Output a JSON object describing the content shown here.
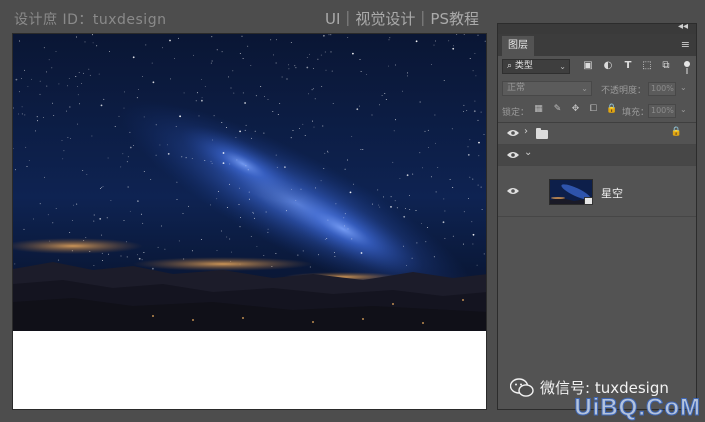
{
  "watermark": {
    "left": "设计庶 ID：tuxdesign",
    "right": "UI｜视觉设计｜PS教程"
  },
  "layers_panel": {
    "tab": "图层",
    "collapse_glyph": "◂◂",
    "menu_glyph": "≡",
    "filter_kind": "类型",
    "filter_icons": [
      "image-filter-icon",
      "adjustment-filter-icon",
      "type-filter-icon",
      "shape-filter-icon",
      "smart-object-filter-icon"
    ],
    "blend_mode": "正常",
    "opacity_label": "不透明度：",
    "opacity_value": "100%",
    "lock_label": "锁定：",
    "fill_label": "填充：",
    "fill_value": "100%",
    "layers": [
      {
        "kind": "group",
        "expanded": false,
        "locked": true,
        "visible": true
      },
      {
        "kind": "group",
        "expanded": true,
        "locked": false,
        "visible": true
      },
      {
        "kind": "smart-object",
        "name": "星空",
        "visible": true
      }
    ]
  },
  "footer": {
    "wechat_text": "微信号: tuxdesign",
    "site_logo": "UiBQ.CoM"
  },
  "colors": {
    "panel_bg": "#535353",
    "workspace_bg": "#4d4d4d",
    "sky_top": "#0b1a3c",
    "milky_way": "#3d6bd6"
  }
}
